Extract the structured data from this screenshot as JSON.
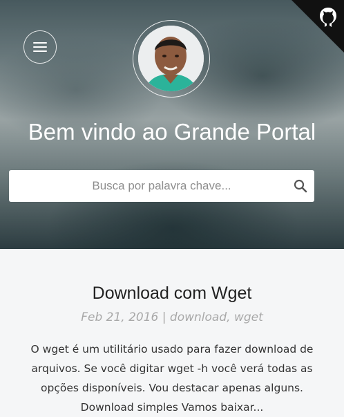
{
  "header": {
    "title": "Bem vindo ao Grande Portal",
    "menu_icon": "hamburger-menu-icon",
    "corner_icon": "github-octocat-icon",
    "avatar_alt": "avatar"
  },
  "search": {
    "placeholder": "Busca por palavra chave...",
    "icon": "search-icon"
  },
  "post": {
    "title": "Download com Wget",
    "date": "Feb 21, 2016",
    "separator": " | ",
    "categories": [
      "download",
      "wget"
    ],
    "excerpt": "O wget é um utilitário usado para fazer download de arquivos. Se você digitar wget -h você verá todas as opções disponíveis. Vou destacar apenas alguns. Download simples Vamos baixar..."
  },
  "colors": {
    "title_text": "#ffffff",
    "meta_text": "#a8a8a8",
    "body_background": "#f5f6f7"
  }
}
